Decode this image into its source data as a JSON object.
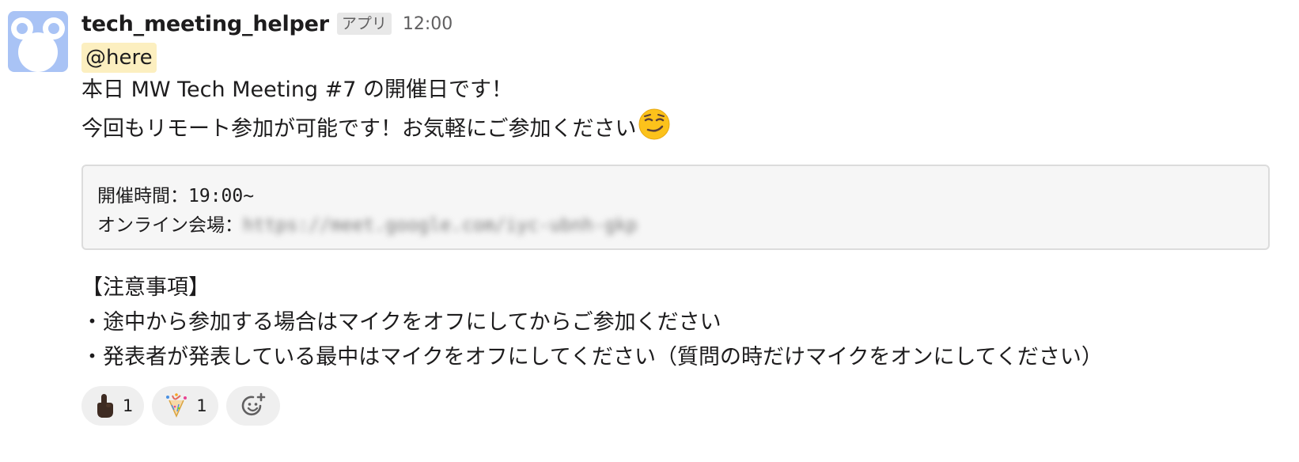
{
  "message": {
    "username": "tech_meeting_helper",
    "app_badge": "アプリ",
    "timestamp": "12:00",
    "mention": "@here",
    "lines": [
      "本日 MW Tech Meeting #7 の開催日です！",
      "今回もリモート参加が可能です！お気軽にご参加ください"
    ],
    "emoji_inline": "smirking-face-emoji",
    "codeblock": {
      "time_label": "開催時間：",
      "time_value": "19:00~",
      "venue_label": "オンライン会場：",
      "venue_value": "https://meet.google.com/iyc-ubnh-gkp"
    },
    "notes": {
      "heading": "【注意事項】",
      "items": [
        "・途中から参加する場合はマイクをオフにしてからご参加ください",
        "・発表者が発表している最中はマイクをオフにしてください（質問の時だけマイクをオンにしてください）"
      ]
    },
    "reactions": [
      {
        "icon": "pointing-up-icon",
        "count": "1"
      },
      {
        "icon": "party-popper-icon",
        "count": "1"
      }
    ],
    "add_reaction_icon": "add-reaction-icon"
  },
  "colors": {
    "avatar_bg": "#a9c3f5",
    "mention_bg": "#fcefc0",
    "codeblock_bg": "#f6f6f6"
  }
}
